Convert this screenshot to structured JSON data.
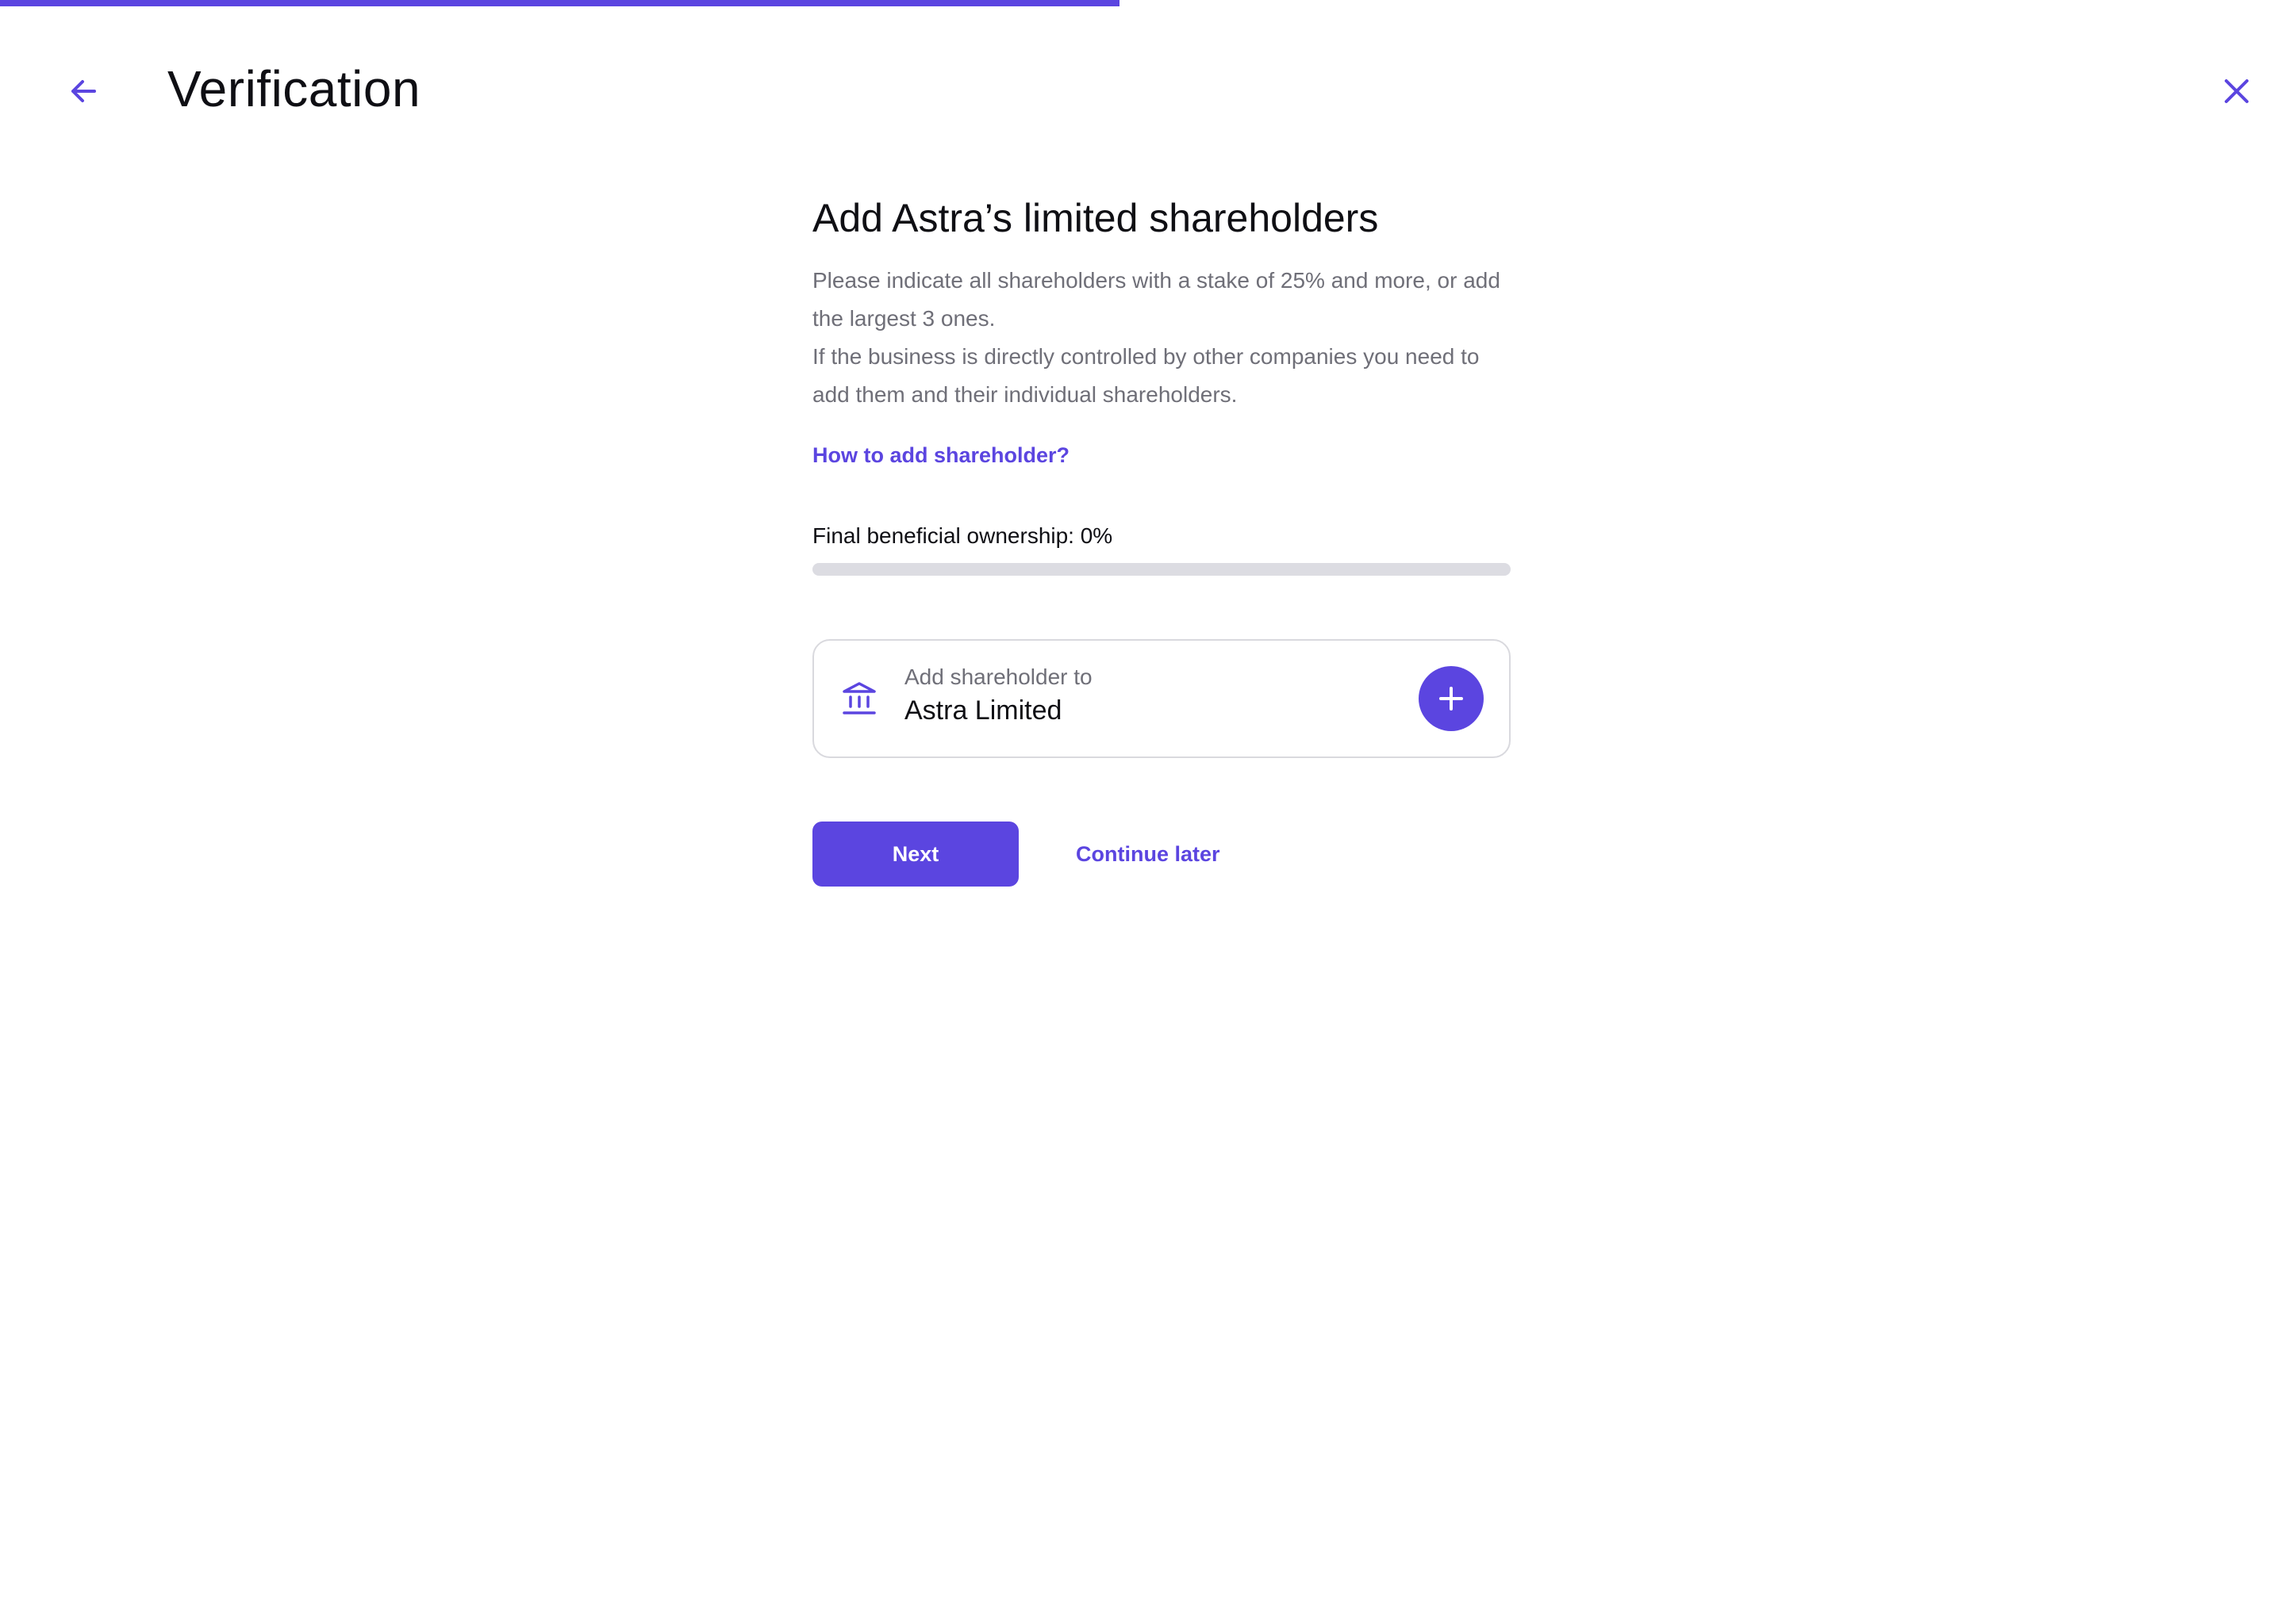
{
  "colors": {
    "accent": "#5b45e0",
    "track": "#dcdce2",
    "muted_text": "#6f6f78",
    "text": "#0f0f14"
  },
  "progress": {
    "wizard_fraction": 0.49
  },
  "header": {
    "title": "Verification",
    "back_icon": "arrow-left-icon",
    "close_icon": "close-icon"
  },
  "main": {
    "title": "Add Astra’s limited shareholders",
    "description_lines": [
      "Please indicate all shareholders with a stake of 25% and more, or add the largest 3 ones.",
      "If the business is directly controlled by other companies you need to add them and their individual shareholders."
    ],
    "help_link": "How to add shareholder?",
    "ownership": {
      "label": "Final beneficial ownership: 0%",
      "percent": 0
    },
    "shareholder_card": {
      "icon": "bank-icon",
      "caption": "Add shareholder to",
      "company": "Astra Limited",
      "add_icon": "plus-icon"
    },
    "actions": {
      "next_label": "Next",
      "later_label": "Continue later"
    }
  }
}
